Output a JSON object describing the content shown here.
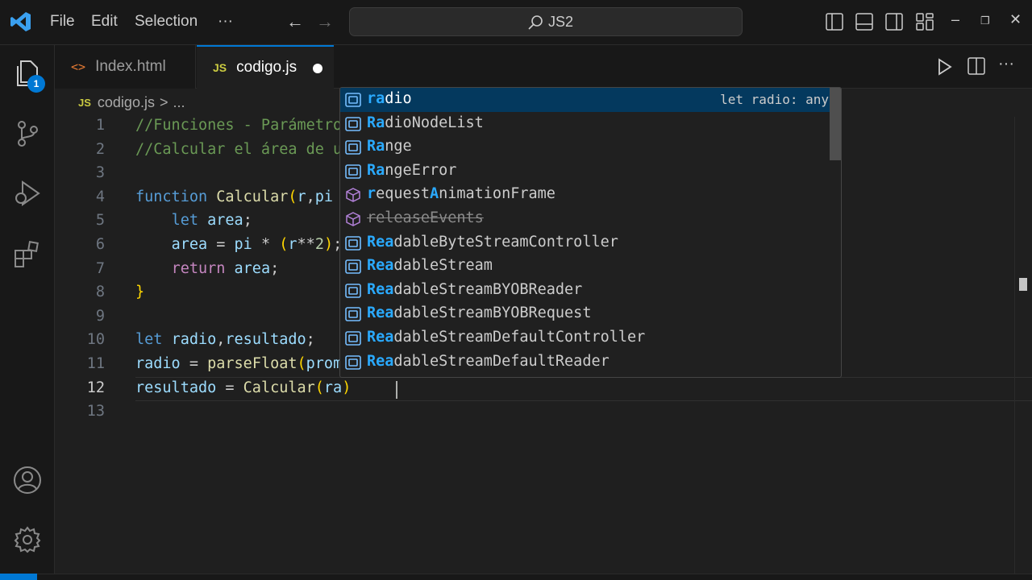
{
  "titlebar": {
    "menus": [
      "File",
      "Edit",
      "Selection",
      "···"
    ],
    "search_text": "JS2",
    "window_controls": {
      "minimize": "–",
      "restore": "❐",
      "close": "✕"
    }
  },
  "activity": {
    "badge": "1",
    "icons": [
      "explorer-icon",
      "source-control-icon",
      "run-debug-icon",
      "extensions-icon",
      "accounts-icon",
      "manage-gear-icon"
    ]
  },
  "tabs": [
    {
      "label": "Index.html",
      "icon": "<>",
      "active": false
    },
    {
      "label": "codigo.js",
      "icon": "JS",
      "active": true,
      "dirty": true
    }
  ],
  "breadcrumb": {
    "icon": "JS",
    "file": "codigo.js",
    "separator": ">",
    "more": "..."
  },
  "editor": {
    "line_numbers": [
      "1",
      "2",
      "3",
      "4",
      "5",
      "6",
      "7",
      "8",
      "9",
      "10",
      "11",
      "12",
      "13"
    ],
    "active_line": 12,
    "lines": [
      "//Funciones - Parámetro",
      "//Calcular el área de u",
      "",
      "function Calcular(r,pi",
      "    let area;",
      "    area = pi * (r**2);",
      "    return area;",
      "}",
      "",
      "let radio,resultado;",
      "radio = parseFloat(prom",
      "resultado = Calcular(ra)",
      ""
    ]
  },
  "suggest": {
    "items": [
      {
        "match": "ra",
        "rest": "dio",
        "kind": "variable",
        "detail": "let radio: any",
        "selected": true
      },
      {
        "match": "Ra",
        "rest": "dioNodeList",
        "kind": "variable"
      },
      {
        "match": "Ra",
        "rest": "nge",
        "kind": "variable"
      },
      {
        "match": "Ra",
        "rest": "ngeError",
        "kind": "variable"
      },
      {
        "match": "r",
        "rest": "equestAnimationFrame",
        "kind": "method",
        "match2": "A",
        "rest2": "nimationFrame",
        "pre": "equest"
      },
      {
        "match": "",
        "rest": "releaseEvents",
        "kind": "method",
        "deprecated": true
      },
      {
        "match": "Rea",
        "rest": "dableByteStreamController",
        "kind": "variable"
      },
      {
        "match": "Rea",
        "rest": "dableStream",
        "kind": "variable"
      },
      {
        "match": "Rea",
        "rest": "dableStreamBYOBReader",
        "kind": "variable"
      },
      {
        "match": "Rea",
        "rest": "dableStreamBYOBRequest",
        "kind": "variable"
      },
      {
        "match": "Rea",
        "rest": "dableStreamDefaultController",
        "kind": "variable"
      },
      {
        "match": "Rea",
        "rest": "dableStreamDefaultReader",
        "kind": "variable"
      }
    ]
  },
  "colors": {
    "accent": "#0078d4",
    "comment": "#6a9955",
    "keyword": "#569cd6",
    "function": "#dcdcaa",
    "variable": "#9cdcfe",
    "match_highlight": "#2aaaff"
  }
}
